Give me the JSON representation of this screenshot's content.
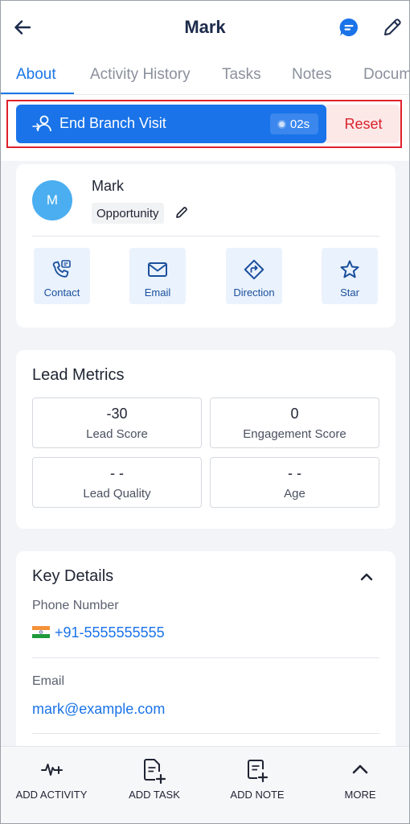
{
  "header": {
    "title": "Mark"
  },
  "tabs": [
    {
      "label": "About",
      "active": true
    },
    {
      "label": "Activity History"
    },
    {
      "label": "Tasks"
    },
    {
      "label": "Notes"
    },
    {
      "label": "Documents"
    }
  ],
  "visit": {
    "label": "End Branch Visit",
    "timer": "02s",
    "reset_label": "Reset"
  },
  "profile": {
    "avatar_initial": "M",
    "name": "Mark",
    "stage": "Opportunity",
    "actions": [
      {
        "label": "Contact",
        "icon": "phone-chat-icon"
      },
      {
        "label": "Email",
        "icon": "mail-icon"
      },
      {
        "label": "Direction",
        "icon": "direction-icon"
      },
      {
        "label": "Star",
        "icon": "star-icon"
      }
    ]
  },
  "metrics": {
    "title": "Lead Metrics",
    "items": [
      {
        "value": "-30",
        "label": "Lead Score"
      },
      {
        "value": "0",
        "label": "Engagement Score"
      },
      {
        "value": "- -",
        "label": "Lead Quality"
      },
      {
        "value": "- -",
        "label": "Age"
      }
    ]
  },
  "details": {
    "title": "Key Details",
    "phone_label": "Phone Number",
    "phone": "+91-5555555555",
    "email_label": "Email",
    "email": "mark@example.com"
  },
  "bottom_bar": [
    {
      "label": "ADD ACTIVITY",
      "icon": "activity-plus-icon"
    },
    {
      "label": "ADD TASK",
      "icon": "task-plus-icon"
    },
    {
      "label": "ADD NOTE",
      "icon": "note-plus-icon"
    },
    {
      "label": "MORE",
      "icon": "chevron-up-icon"
    }
  ],
  "colors": {
    "accent": "#1a73e8",
    "danger": "#d9232d",
    "avatar": "#4aaef0"
  }
}
